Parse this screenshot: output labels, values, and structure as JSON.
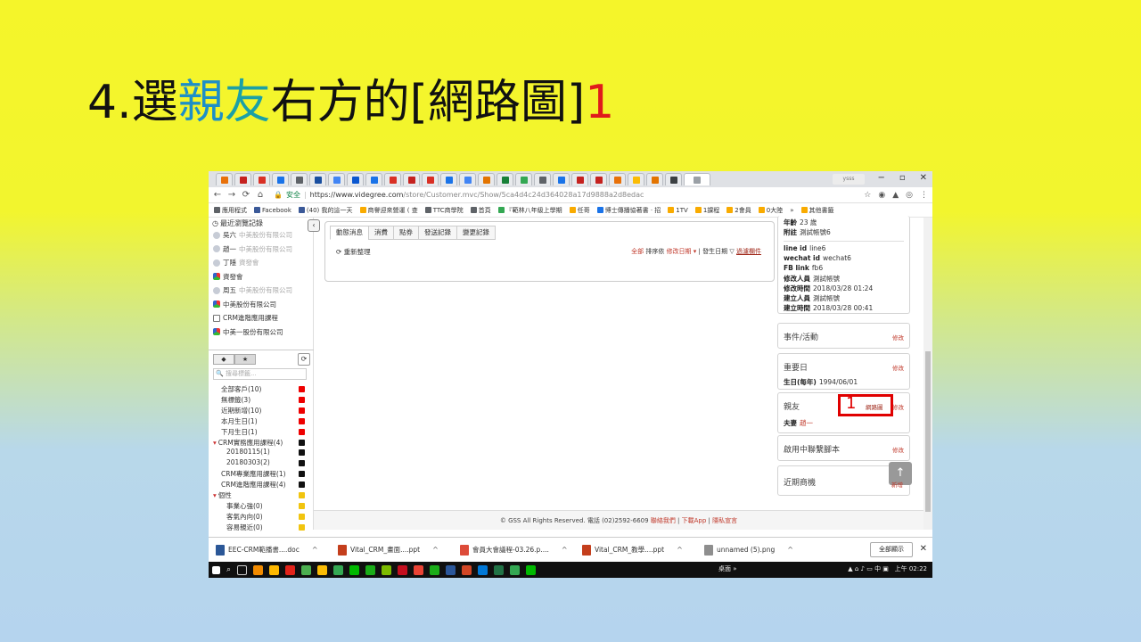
{
  "slide": {
    "title_num": "4.選",
    "title_c1": "親",
    "title_c2": "友",
    "title_rest": "右方的[網路圖]",
    "title_marker": "1"
  },
  "browser": {
    "user_pill": "ysss",
    "secure_label": "安全",
    "url_host": "https://www.videgree.com",
    "url_path": "/store/Customer.mvc/Show/5ca4d4c24d364028a17d9888a2d8edac"
  },
  "bookmarks": [
    "應用程式",
    "Facebook",
    "(40) 我的這一天",
    "商譽迎來營運 ( 查 ",
    "TTC商學院",
    "首頁",
    "『範林八年級上學期",
    "任哥",
    "博士傳播協著書 · 招",
    "1TV",
    "1課程",
    "2會員",
    "0大陸",
    "»",
    "其他書籤"
  ],
  "recent": {
    "heading": "最近瀏覽記錄",
    "items": [
      {
        "name": "吳六",
        "sub": "中美股份有限公司",
        "type": "person"
      },
      {
        "name": "趙一",
        "sub": "中美股份有限公司",
        "type": "person"
      },
      {
        "name": "丁隱",
        "sub": "資發會",
        "type": "person"
      },
      {
        "name": "資發會",
        "sub": "",
        "type": "group"
      },
      {
        "name": "周五",
        "sub": "中美股份有限公司",
        "type": "person"
      },
      {
        "name": "中美股份有限公司",
        "sub": "",
        "type": "group"
      },
      {
        "name": "CRM進階應用課程",
        "sub": "",
        "type": "tag"
      },
      {
        "name": "中美一股份有限公司",
        "sub": "",
        "type": "group"
      }
    ]
  },
  "tags": {
    "search_placeholder": "搜尋標籤...",
    "rows": [
      {
        "label": "全部客戶(10)",
        "mark": "red",
        "kind": "plain"
      },
      {
        "label": "無標籤(3)",
        "mark": "red",
        "kind": "plain"
      },
      {
        "label": "近期新增(10)",
        "mark": "red",
        "kind": "plain"
      },
      {
        "label": "本月生日(1)",
        "mark": "red",
        "kind": "plain"
      },
      {
        "label": "下月生日(1)",
        "mark": "red",
        "kind": "plain"
      },
      {
        "label": "CRM實務應用課程(4)",
        "mark": "blk",
        "kind": "group"
      },
      {
        "label": "20180115(1)",
        "mark": "blk",
        "kind": "indent"
      },
      {
        "label": "20180303(2)",
        "mark": "blk",
        "kind": "indent"
      },
      {
        "label": "CRM專業應用課程(1)",
        "mark": "blk",
        "kind": "plain"
      },
      {
        "label": "CRM進階應用課程(4)",
        "mark": "blk",
        "kind": "plain"
      },
      {
        "label": "個性",
        "mark": "yel",
        "kind": "group"
      },
      {
        "label": "事業心強(0)",
        "mark": "yel",
        "kind": "indent"
      },
      {
        "label": "客氣內向(0)",
        "mark": "yel",
        "kind": "indent"
      },
      {
        "label": "容易親近(0)",
        "mark": "yel",
        "kind": "indent"
      }
    ]
  },
  "main": {
    "tabs": [
      "動態消息",
      "消費",
      "點券",
      "發送記錄",
      "變更記錄"
    ],
    "reorder": "重新整理",
    "sort_all": "全部",
    "sort_label": "排序依",
    "sort_field": "修改日期 ▾",
    "sort_sep": "| 發生日期",
    "filter": "過濾欄件"
  },
  "right": {
    "age": {
      "k": "年齡",
      "v": "23 歲"
    },
    "note": {
      "k": "附註",
      "v": "測試帳號6"
    },
    "fields": [
      {
        "k": "line id",
        "v": "line6"
      },
      {
        "k": "wechat id",
        "v": "wechat6"
      },
      {
        "k": "FB link",
        "v": "fb6"
      },
      {
        "k": "修改人員",
        "v": "測試帳號"
      },
      {
        "k": "修改時間",
        "v": "2018/03/28 01:24"
      },
      {
        "k": "建立人員",
        "v": "測試帳號"
      },
      {
        "k": "建立時間",
        "v": "2018/03/28 00:41"
      }
    ],
    "events_title": "事件/活動",
    "important_title": "重要日",
    "birthday": {
      "k": "生日(每年)",
      "v": "1994/06/01"
    },
    "relatives_title": "親友",
    "relation_map": "網路圖",
    "marker": "1",
    "spouse": {
      "k": "夫妻",
      "v": "趙一"
    },
    "contact_title": "啟用中聯繫腳本",
    "opportunity_title": "近期商機",
    "edit": "修改",
    "add": "新增"
  },
  "footer": {
    "text": "© GSS All Rights Reserved. 電話 (02)2592-6609",
    "link1": "聯絡我們",
    "link2": "下載App",
    "link3": "隱私宣言"
  },
  "downloads": {
    "items": [
      {
        "name": "EEC-CRM範播書....doc",
        "color": "#2b5797"
      },
      {
        "name": "Vital_CRM_畫面....ppt",
        "color": "#c43e1c"
      },
      {
        "name": "會員大會議程-03.26.p....",
        "color": "#dd4b39"
      },
      {
        "name": "Vital_CRM_教學....ppt",
        "color": "#c43e1c"
      },
      {
        "name": "unnamed (5).png",
        "color": "#8e8e8e"
      }
    ],
    "show_all": "全部顯示"
  },
  "taskbar": {
    "desktop": "桌面 »",
    "tray": "中",
    "time": "上午 02:22"
  }
}
